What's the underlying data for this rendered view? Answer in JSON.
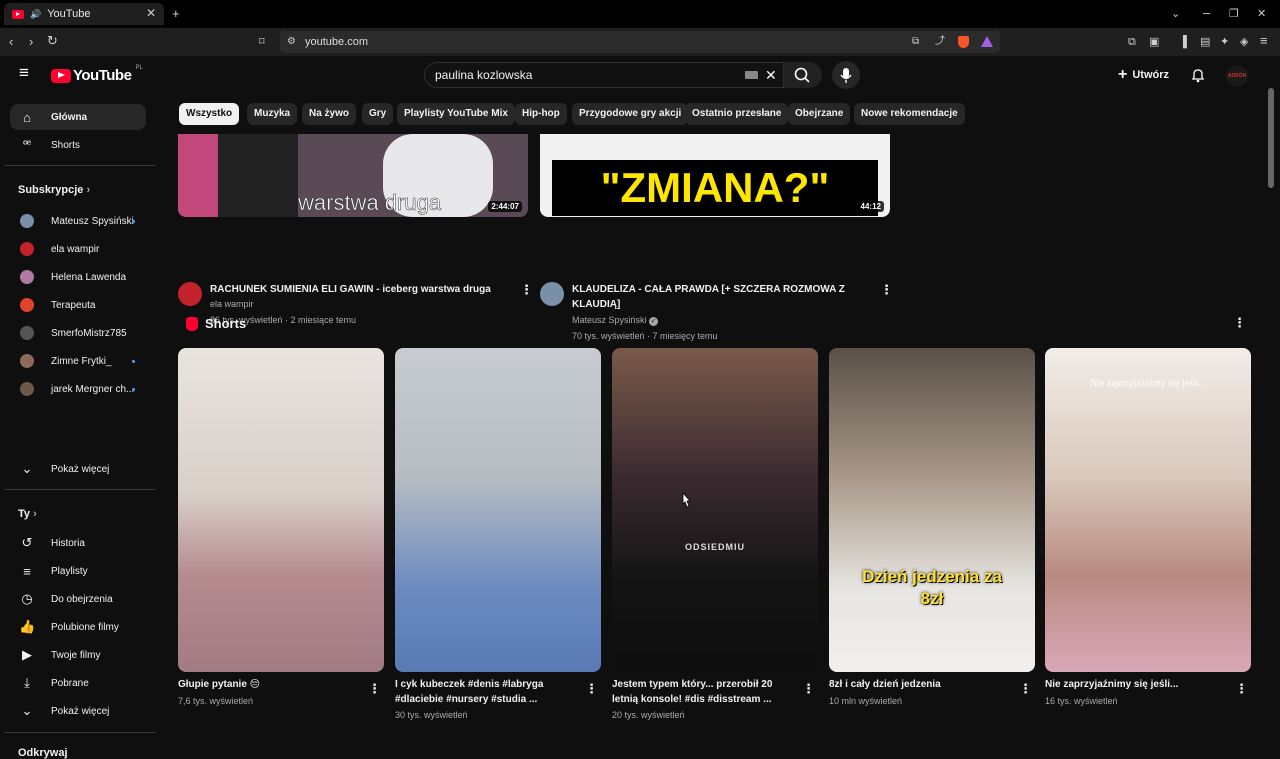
{
  "browser": {
    "tab_title": "YouTube",
    "url": "youtube.com"
  },
  "header": {
    "logo_text": "YouTube",
    "logo_region": "PL",
    "search_value": "paulina kozlowska",
    "create_label": "Utwórz",
    "avatar_text": "ADRON"
  },
  "chips": [
    "Wszystko",
    "Muzyka",
    "Na żywo",
    "Gry",
    "Playlisty YouTube Mix",
    "Hip-hop",
    "Przygodowe gry akcji",
    "Ostatnio przesłane",
    "Obejrzane",
    "Nowe rekomendacje"
  ],
  "sidebar": {
    "home": "Główna",
    "shorts": "Shorts",
    "subs_header": "Subskrypcje",
    "subs": [
      {
        "name": "Mateusz Spysiński",
        "color": "#7a8fa8"
      },
      {
        "name": "ela wampir",
        "color": "#c2232a"
      },
      {
        "name": "Helena Lawenda",
        "color": "#b07aa1"
      },
      {
        "name": "Terapeuta",
        "color": "#e0432b"
      },
      {
        "name": "SmerfoMistrz785",
        "color": "#555555"
      },
      {
        "name": "Zimne Frytki_",
        "color": "#8a6a5a"
      },
      {
        "name": "jarek Mergner ch...",
        "color": "#6b5a4a"
      }
    ],
    "show_more": "Pokaż więcej",
    "you_header": "Ty",
    "you_items": [
      "Historia",
      "Playlisty",
      "Do obejrzenia",
      "Polubione filmy",
      "Twoje filmy",
      "Pobrane",
      "Pokaż więcej"
    ],
    "explore_header": "Odkrywaj"
  },
  "videos": [
    {
      "title": "RACHUNEK SUMIENIA ELI GAWIN - iceberg warstwa druga",
      "channel": "ela wampir",
      "meta": "86 tys. wyświetleń · 2 miesiące temu",
      "duration": "2:44:07",
      "thumb_text": "warstwa druga"
    },
    {
      "title": "KLAUDELIZA - CAŁA PRAWDA [+ SZCZERA ROZMOWA Z KLAUDIĄ]",
      "channel": "Mateusz Spysiński",
      "meta": "70 tys. wyświetleń · 7 miesięcy temu",
      "duration": "44:12",
      "thumb_text": "\"ZMIANA?\""
    }
  ],
  "shorts": {
    "header": "Shorts",
    "items": [
      {
        "title": "Głupie pytanie 😔",
        "views": "7,6 tys. wyświetleń",
        "overlay": ""
      },
      {
        "title": "I cyk kubeczek #denis #labryga #dlaciebie #nursery #studia ...",
        "views": "30 tys. wyświetleń",
        "overlay": ""
      },
      {
        "title": "Jestem typem który... przerobił 20 letnią konsole! #dis #disstream ...",
        "views": "20 tys. wyświetleń",
        "overlay": "ODSIEDMIU"
      },
      {
        "title": "8zł i cały dzień jedzenia",
        "views": "10 mln wyświetleń",
        "overlay": "Dzień jedzenia za 8zł"
      },
      {
        "title": "Nie zaprzyjaźnimy się jeśli...",
        "views": "16 tys. wyświetleń",
        "overlay": "Nie zaprzyjaźnimy się jeśli..."
      }
    ]
  }
}
